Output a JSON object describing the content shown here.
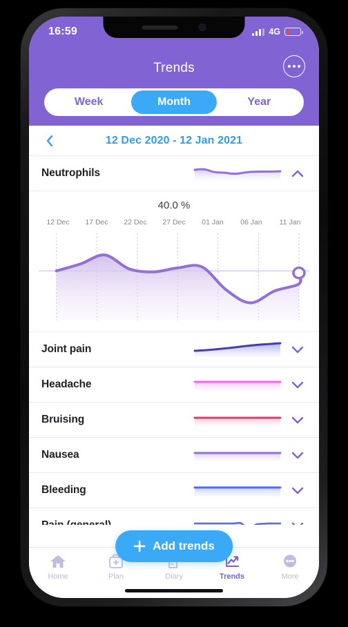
{
  "status_bar": {
    "time": "16:59",
    "network": "4G",
    "signal_icon": "signal-bars-icon",
    "battery_icon": "battery-low-icon",
    "battery_percent": 26
  },
  "header": {
    "title": "Trends",
    "overflow_icon": "more-dots-circle-icon"
  },
  "segmented_control": {
    "options": [
      {
        "label": "Week",
        "active": false
      },
      {
        "label": "Month",
        "active": true
      },
      {
        "label": "Year",
        "active": false
      }
    ],
    "active_color": "#3aaaf7",
    "inactive_text_color": "#8163d4"
  },
  "date_nav": {
    "prev_icon": "chevron-left-icon",
    "range": "12 Dec 2020 - 12 Jan 2021",
    "link_color": "#2f9cf4"
  },
  "expanded_trend": {
    "name": "Neutrophils",
    "value_label": "40.0 %",
    "collapse_icon": "chevron-up-icon",
    "line_color": "#9370d4"
  },
  "chart_data": {
    "type": "area",
    "title": "Neutrophils",
    "value_label": "40.0 %",
    "xlabel": "",
    "ylabel": "%",
    "grid": true,
    "legend": "none",
    "tick_labels": [
      "12 Dec",
      "17 Dec",
      "22 Dec",
      "27 Dec",
      "01 Jan",
      "06 Jan",
      "11 Jan"
    ],
    "x": [
      0,
      3,
      6,
      9,
      12,
      15,
      18,
      21,
      24,
      27,
      30
    ],
    "y": [
      40.0,
      43.5,
      48.0,
      41.0,
      39.5,
      41.5,
      42.0,
      30.5,
      24.0,
      30.0,
      33.5
    ],
    "y_end": 39.0,
    "reference_line_value": 40.0,
    "ylim": [
      18,
      56
    ],
    "line_color": "#9370d4",
    "fill_top_color": "#cbb6ea",
    "fill_bottom_color": "#f3ecfb",
    "marker": "hollow-circle-end-point"
  },
  "trend_rows": [
    {
      "name": "Joint pain",
      "icon": "chevron-down-icon",
      "line_color": "#4b3da8",
      "fill_color": "#9aa0e0",
      "shape": "rising"
    },
    {
      "name": "Headache",
      "icon": "chevron-down-icon",
      "line_color": "#fb64f0",
      "fill_color": "#fcc3f7",
      "shape": "flat"
    },
    {
      "name": "Bruising",
      "icon": "chevron-down-icon",
      "line_color": "#d43f72",
      "fill_color": "#f5bcd0",
      "shape": "flat"
    },
    {
      "name": "Nausea",
      "icon": "chevron-down-icon",
      "line_color": "#9370d4",
      "fill_color": "#d9cbef",
      "shape": "flat"
    },
    {
      "name": "Bleeding",
      "icon": "chevron-down-icon",
      "line_color": "#4f6df5",
      "fill_color": "#bccaf8",
      "shape": "flat"
    },
    {
      "name": "Pain (general)",
      "icon": "chevron-down-icon",
      "line_color": "#5c6fd0",
      "fill_color": "#c6cff0",
      "shape": "wavy"
    }
  ],
  "add_trends_button": {
    "label": "Add trends",
    "icon": "plus-icon",
    "color": "#3aaaf7"
  },
  "tab_bar": {
    "items": [
      {
        "label": "Home",
        "icon": "home-icon",
        "active": false
      },
      {
        "label": "Plan",
        "icon": "calendar-plus-icon",
        "active": false
      },
      {
        "label": "Diary",
        "icon": "notebook-pen-icon",
        "active": false
      },
      {
        "label": "Trends",
        "icon": "trend-chart-icon",
        "active": true
      },
      {
        "label": "More",
        "icon": "more-dots-icon",
        "active": false
      }
    ],
    "active_color": "#7e5fd2",
    "inactive_color": "#c3bade"
  }
}
